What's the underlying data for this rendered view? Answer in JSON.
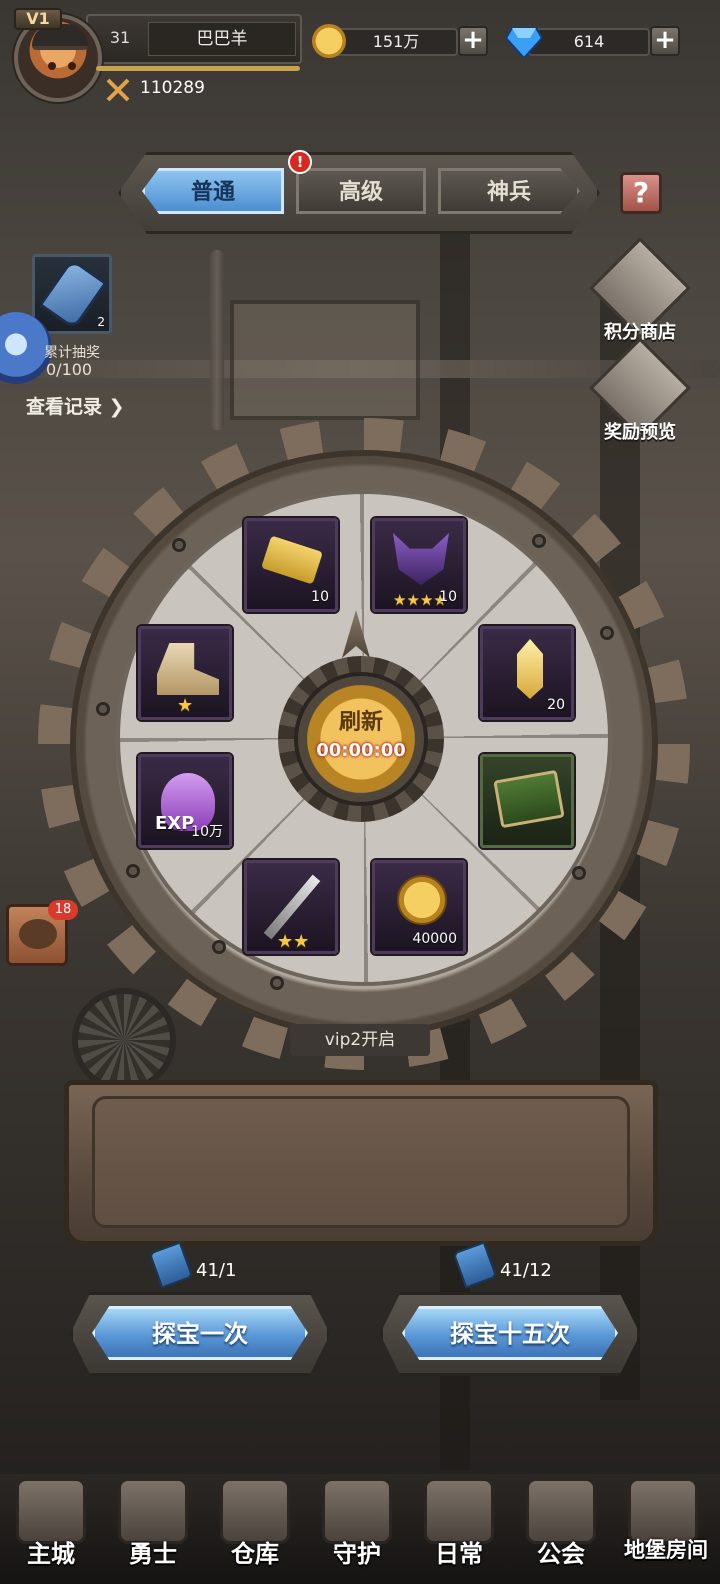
{
  "player": {
    "vip": "V1",
    "level": "31",
    "name": "巴巴羊",
    "power": "110289"
  },
  "resources": {
    "coins": "151万",
    "gems": "614",
    "plus": "+"
  },
  "tabs": [
    {
      "label": "普通",
      "active": true
    },
    {
      "label": "高级",
      "active": false
    },
    {
      "label": "神兵",
      "active": false
    }
  ],
  "alert_badge": "!",
  "help": "?",
  "left_panel": {
    "draw_count": "2",
    "cumulative_label": "累计抽奖",
    "cumulative_progress": "0/100",
    "record_link": "查看记录 ❯"
  },
  "right_panel": {
    "points_shop": "积分商店",
    "reward_preview": "奖励预览"
  },
  "wheel": {
    "hub_label": "刷新",
    "timer": "00:00:00",
    "slots": [
      {
        "name": "ticket",
        "qty": "10",
        "stars": ""
      },
      {
        "name": "wolf-mask",
        "qty": "10",
        "stars": "★★★★"
      },
      {
        "name": "crystal",
        "qty": "20",
        "stars": ""
      },
      {
        "name": "skill-book",
        "qty": "",
        "stars": ""
      },
      {
        "name": "gold-coin",
        "qty": "40000",
        "stars": ""
      },
      {
        "name": "sword",
        "qty": "",
        "stars": "★★"
      },
      {
        "name": "exp-potion",
        "qty": "10万",
        "stars": ""
      },
      {
        "name": "boots",
        "qty": "",
        "stars": "★"
      }
    ]
  },
  "vip_unlock": "vip2开启",
  "chat_badge": "18",
  "actions": [
    {
      "label": "探宝一次",
      "cost": "41/1"
    },
    {
      "label": "探宝十五次",
      "cost": "41/12"
    }
  ],
  "nav": [
    {
      "label": "主城"
    },
    {
      "label": "勇士"
    },
    {
      "label": "仓库"
    },
    {
      "label": "守护"
    },
    {
      "label": "日常"
    },
    {
      "label": "公会"
    },
    {
      "label": "地堡房间"
    }
  ],
  "colors": {
    "accent_blue": "#5a97d6",
    "gold": "#f2c25e",
    "alert": "#d62a1f"
  }
}
